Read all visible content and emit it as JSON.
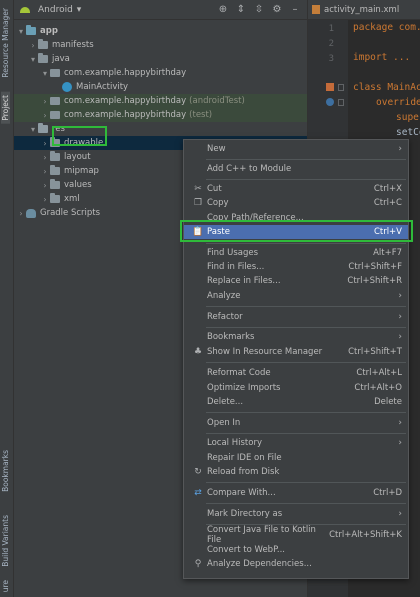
{
  "left_strip": {
    "resource_manager": "Resource Manager",
    "project": "Project",
    "bookmarks": "Bookmarks",
    "build_variants": "Build Variants",
    "structure": "ure"
  },
  "panel": {
    "view_selector": "Android"
  },
  "tree": [
    {
      "label": "app",
      "suffix": ""
    },
    {
      "label": "manifests",
      "suffix": ""
    },
    {
      "label": "java",
      "suffix": ""
    },
    {
      "label": "com.example.happybirthday",
      "suffix": ""
    },
    {
      "label": "MainActivity",
      "suffix": ""
    },
    {
      "label": "com.example.happybirthday",
      "suffix": "(androidTest)"
    },
    {
      "label": "com.example.happybirthday",
      "suffix": "(test)"
    },
    {
      "label": "res",
      "suffix": ""
    },
    {
      "label": "drawable",
      "suffix": ""
    },
    {
      "label": "layout",
      "suffix": ""
    },
    {
      "label": "mipmap",
      "suffix": ""
    },
    {
      "label": "values",
      "suffix": ""
    },
    {
      "label": "xml",
      "suffix": ""
    },
    {
      "label": "Gradle Scripts",
      "suffix": ""
    }
  ],
  "editor": {
    "tab": "activity_main.xml",
    "line_numbers": [
      "1",
      "2",
      "3",
      "",
      "",
      "",
      "",
      ""
    ],
    "lines": [
      "package com.",
      "",
      "import ...",
      "",
      "class MainAct",
      "override",
      "super",
      "setCo"
    ]
  },
  "menu": {
    "new": {
      "label": "New",
      "shortcut": ""
    },
    "add_cpp": {
      "label": "Add C++ to Module",
      "shortcut": ""
    },
    "cut": {
      "label": "Cut",
      "shortcut": "Ctrl+X"
    },
    "copy": {
      "label": "Copy",
      "shortcut": "Ctrl+C"
    },
    "copy_path": {
      "label": "Copy Path/Reference...",
      "shortcut": ""
    },
    "paste": {
      "label": "Paste",
      "shortcut": "Ctrl+V"
    },
    "find_usages": {
      "label": "Find Usages",
      "shortcut": "Alt+F7"
    },
    "find_in_files": {
      "label": "Find in Files...",
      "shortcut": "Ctrl+Shift+F"
    },
    "replace_in_files": {
      "label": "Replace in Files...",
      "shortcut": "Ctrl+Shift+R"
    },
    "analyze": {
      "label": "Analyze",
      "shortcut": ""
    },
    "refactor": {
      "label": "Refactor",
      "shortcut": ""
    },
    "bookmarks": {
      "label": "Bookmarks",
      "shortcut": ""
    },
    "show_resource_manager": {
      "label": "Show In Resource Manager",
      "shortcut": "Ctrl+Shift+T"
    },
    "reformat_code": {
      "label": "Reformat Code",
      "shortcut": "Ctrl+Alt+L"
    },
    "optimize_imports": {
      "label": "Optimize Imports",
      "shortcut": "Ctrl+Alt+O"
    },
    "delete": {
      "label": "Delete...",
      "shortcut": "Delete"
    },
    "open_in": {
      "label": "Open In",
      "shortcut": ""
    },
    "local_history": {
      "label": "Local History",
      "shortcut": ""
    },
    "repair_ide": {
      "label": "Repair IDE on File",
      "shortcut": ""
    },
    "reload_from_disk": {
      "label": "Reload from Disk",
      "shortcut": ""
    },
    "compare_with": {
      "label": "Compare With...",
      "shortcut": "Ctrl+D"
    },
    "mark_directory_as": {
      "label": "Mark Directory as",
      "shortcut": ""
    },
    "convert_java_kotlin": {
      "label": "Convert Java File to Kotlin File",
      "shortcut": "Ctrl+Alt+Shift+K"
    },
    "convert_webp": {
      "label": "Convert to WebP...",
      "shortcut": ""
    },
    "analyze_deps": {
      "label": "Analyze Dependencies...",
      "shortcut": ""
    }
  },
  "colors": {
    "highlight_box": "#2fba3a",
    "menu_active": "#4b6eaf",
    "selected_row": "#0d293e"
  }
}
